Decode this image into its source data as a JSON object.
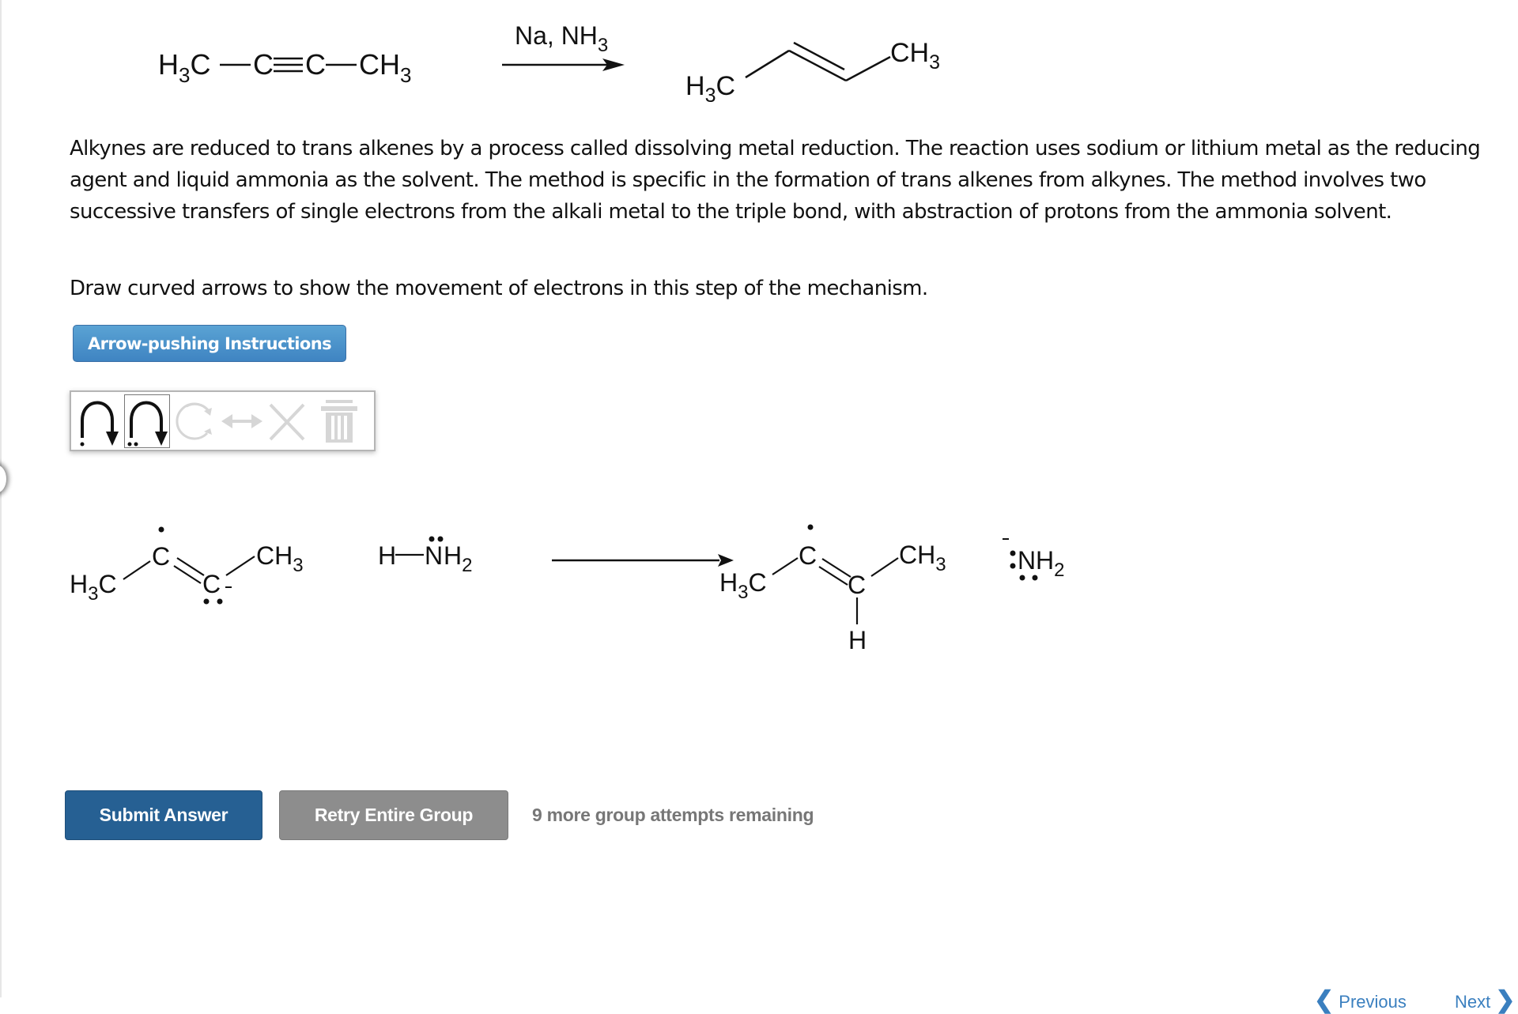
{
  "reaction": {
    "reactant": {
      "left": "H3C",
      "triple_left": "C",
      "triple_right": "C",
      "right": "CH3"
    },
    "reagents": "Na, NH3",
    "product": {
      "left": "H3C",
      "right": "CH3"
    }
  },
  "description": "Alkynes are reduced to trans alkenes by a process called dissolving metal reduction. The reaction uses sodium or lithium metal as the reducing agent and liquid ammonia as the solvent. The method is specific in the formation of trans alkenes from alkynes. The method involves two successive transfers of single electrons from the alkali metal to the triple bond, with abstraction of protons from the ammonia solvent.",
  "instruction": "Draw curved arrows to show the movement of electrons in this step of the mechanism.",
  "instructions_button": "Arrow-pushing Instructions",
  "toolbar": {
    "tools": [
      {
        "icon": "single-electron-arrow-icon",
        "enabled": true,
        "selected": false
      },
      {
        "icon": "electron-pair-arrow-icon",
        "enabled": true,
        "selected": true
      },
      {
        "icon": "rotate-icon",
        "enabled": false
      },
      {
        "icon": "resonance-arrow-icon",
        "enabled": false
      },
      {
        "icon": "delete-x-icon",
        "enabled": false
      },
      {
        "icon": "trash-icon",
        "enabled": false
      }
    ]
  },
  "mechanism": {
    "reactant_anion": {
      "h3c": "H3C",
      "c1": "C",
      "c2": "C",
      "ch3": "CH3",
      "charge": "-"
    },
    "ammonia": {
      "h": "H",
      "n": "N",
      "h2": "H",
      "sub": "2"
    },
    "product_radical": {
      "h3c": "H3C",
      "c1": "C",
      "c2": "C",
      "ch3": "CH3",
      "h": "H"
    },
    "amide": {
      "n": "N",
      "h": "H",
      "sub": "2",
      "charge": "-"
    }
  },
  "actions": {
    "submit": "Submit Answer",
    "retry": "Retry Entire Group",
    "attempts": "9 more group attempts remaining"
  },
  "navigation": {
    "previous": "Previous",
    "next": "Next"
  }
}
